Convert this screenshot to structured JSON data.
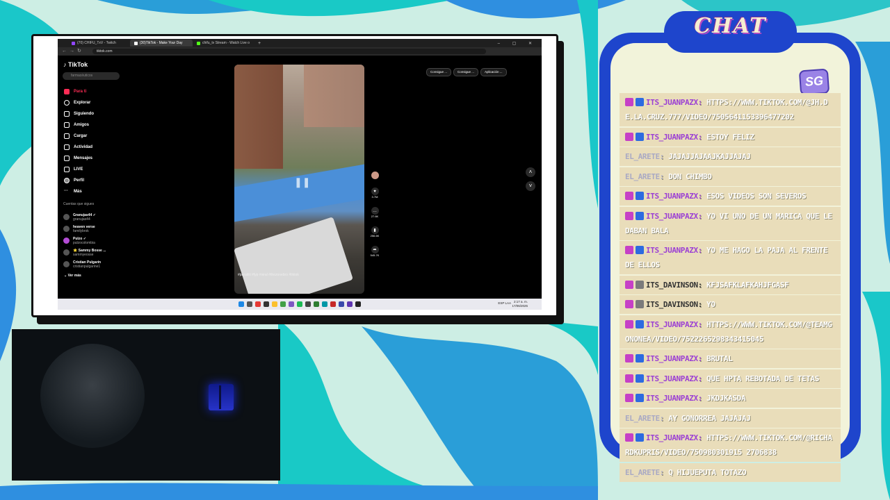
{
  "browser": {
    "tabs": [
      {
        "label": "(70) CHIFU_TxV - Twitch",
        "color": "#9146ff"
      },
      {
        "label": "(30)TikTok - Make Your Day",
        "color": "#ffffff"
      },
      {
        "label": "chifu_tv Stream - Watch Live o",
        "color": "#53fc18"
      }
    ],
    "url": "tiktok.com"
  },
  "tiktok": {
    "logo": "TikTok",
    "search_placeholder": "farmacéuticos",
    "nav": [
      "Para ti",
      "Explorar",
      "Siguiendo",
      "Amigos",
      "Cargar",
      "Actividad",
      "Mensajes",
      "LIVE",
      "Perfil",
      "Más"
    ],
    "following_title": "Cuentas que sigues",
    "following": [
      {
        "name": "Granujas44 ✓",
        "handle": "granujas44"
      },
      {
        "name": "heaven verse",
        "handle": "familybrok"
      },
      {
        "name": "Pulzo ✓",
        "handle": "pulzocolombia"
      },
      {
        "name": "⭐ Sammy Bosse ...",
        "handle": "sammyeosse"
      },
      {
        "name": "Cristian Pulgarín",
        "handle": "cristianpulgarine1"
      }
    ],
    "see_more": "Ver más",
    "top_buttons": [
      "Consigue ...",
      "Consigue ...",
      "Aplicación ..."
    ],
    "video_caption": "#paratiiii #fyp #viral #thezonebro #tiktok",
    "actions": [
      {
        "icon": "heart-icon",
        "count": "3.7M"
      },
      {
        "icon": "comment-icon",
        "count": "27.6K"
      },
      {
        "icon": "bookmark-icon",
        "count": "256.6K"
      },
      {
        "icon": "share-icon",
        "count": "545.7K"
      }
    ]
  },
  "taskbar": {
    "tray_lang": "ESP LAA",
    "clock_time": "2:17 a. m.",
    "clock_date": "17/06/2025"
  },
  "chat": {
    "title": "CHAT",
    "logo_text": "SG",
    "messages": [
      {
        "user": "ITS_JUANPAZX",
        "badges": [
          "sub",
          "verified"
        ],
        "color": "#9b3fd4",
        "text": "HTTPS://WWW.TIKTOK.COM/@JH.DE.LA.CRUZ.777/VIDEO/7505641153396477202"
      },
      {
        "user": "ITS_JUANPAZX",
        "badges": [
          "sub",
          "verified"
        ],
        "color": "#9b3fd4",
        "text": "ESTOY FELIZ"
      },
      {
        "user": "EL_ARETE",
        "badges": [],
        "color": "#a9a9c4",
        "text": "JAJAJJAJAAJKAJJAJAJ"
      },
      {
        "user": "EL_ARETE",
        "badges": [],
        "color": "#a9a9c4",
        "text": "DON CHIMBO"
      },
      {
        "user": "ITS_JUANPAZX",
        "badges": [
          "sub",
          "verified"
        ],
        "color": "#9b3fd4",
        "text": "ESOS VIDEOS SON SEVEROS"
      },
      {
        "user": "ITS_JUANPAZX",
        "badges": [
          "sub",
          "verified"
        ],
        "color": "#9b3fd4",
        "text": "YO VI UNO DE UN MARICA QUE LE DABAN BALA"
      },
      {
        "user": "ITS_JUANPAZX",
        "badges": [
          "sub",
          "verified"
        ],
        "color": "#9b3fd4",
        "text": "YO ME HAGO LA PAJA AL FRENTE DE ELLOS"
      },
      {
        "user": "ITS_DAVINSON",
        "badges": [
          "sub",
          "bits"
        ],
        "color": "#333333",
        "text": "KFJSAFKLAFKAHJFGASF"
      },
      {
        "user": "ITS_DAVINSON",
        "badges": [
          "sub",
          "bits"
        ],
        "color": "#333333",
        "text": "YO"
      },
      {
        "user": "ITS_JUANPAZX",
        "badges": [
          "sub",
          "verified"
        ],
        "color": "#9b3fd4",
        "text": "HTTPS://WWW.TIKTOK.COM/@TEAMGONONEA/VIDEO/7522265298343415045"
      },
      {
        "user": "ITS_JUANPAZX",
        "badges": [
          "sub",
          "verified"
        ],
        "color": "#9b3fd4",
        "text": "BRUTAL"
      },
      {
        "user": "ITS_JUANPAZX",
        "badges": [
          "sub",
          "verified"
        ],
        "color": "#9b3fd4",
        "text": "QUE HPTA REBOTADA DE TETAS"
      },
      {
        "user": "ITS_JUANPAZX",
        "badges": [
          "sub",
          "verified"
        ],
        "color": "#9b3fd4",
        "text": "JKDJKASDA"
      },
      {
        "user": "EL_ARETE",
        "badges": [],
        "color": "#a9a9c4",
        "text": "AY GONORREA JAJAJAJ"
      },
      {
        "user": "ITS_JUANPAZX",
        "badges": [
          "sub",
          "verified"
        ],
        "color": "#9b3fd4",
        "text": "HTTPS://WWW.TIKTOK.COM/@RICHARDKUPRIS/VIDEO/750980301915 2706838"
      },
      {
        "user": "EL_ARETE",
        "badges": [],
        "color": "#a9a9c4",
        "text": "Q HIJUEPUTA TOTAZO"
      }
    ]
  }
}
